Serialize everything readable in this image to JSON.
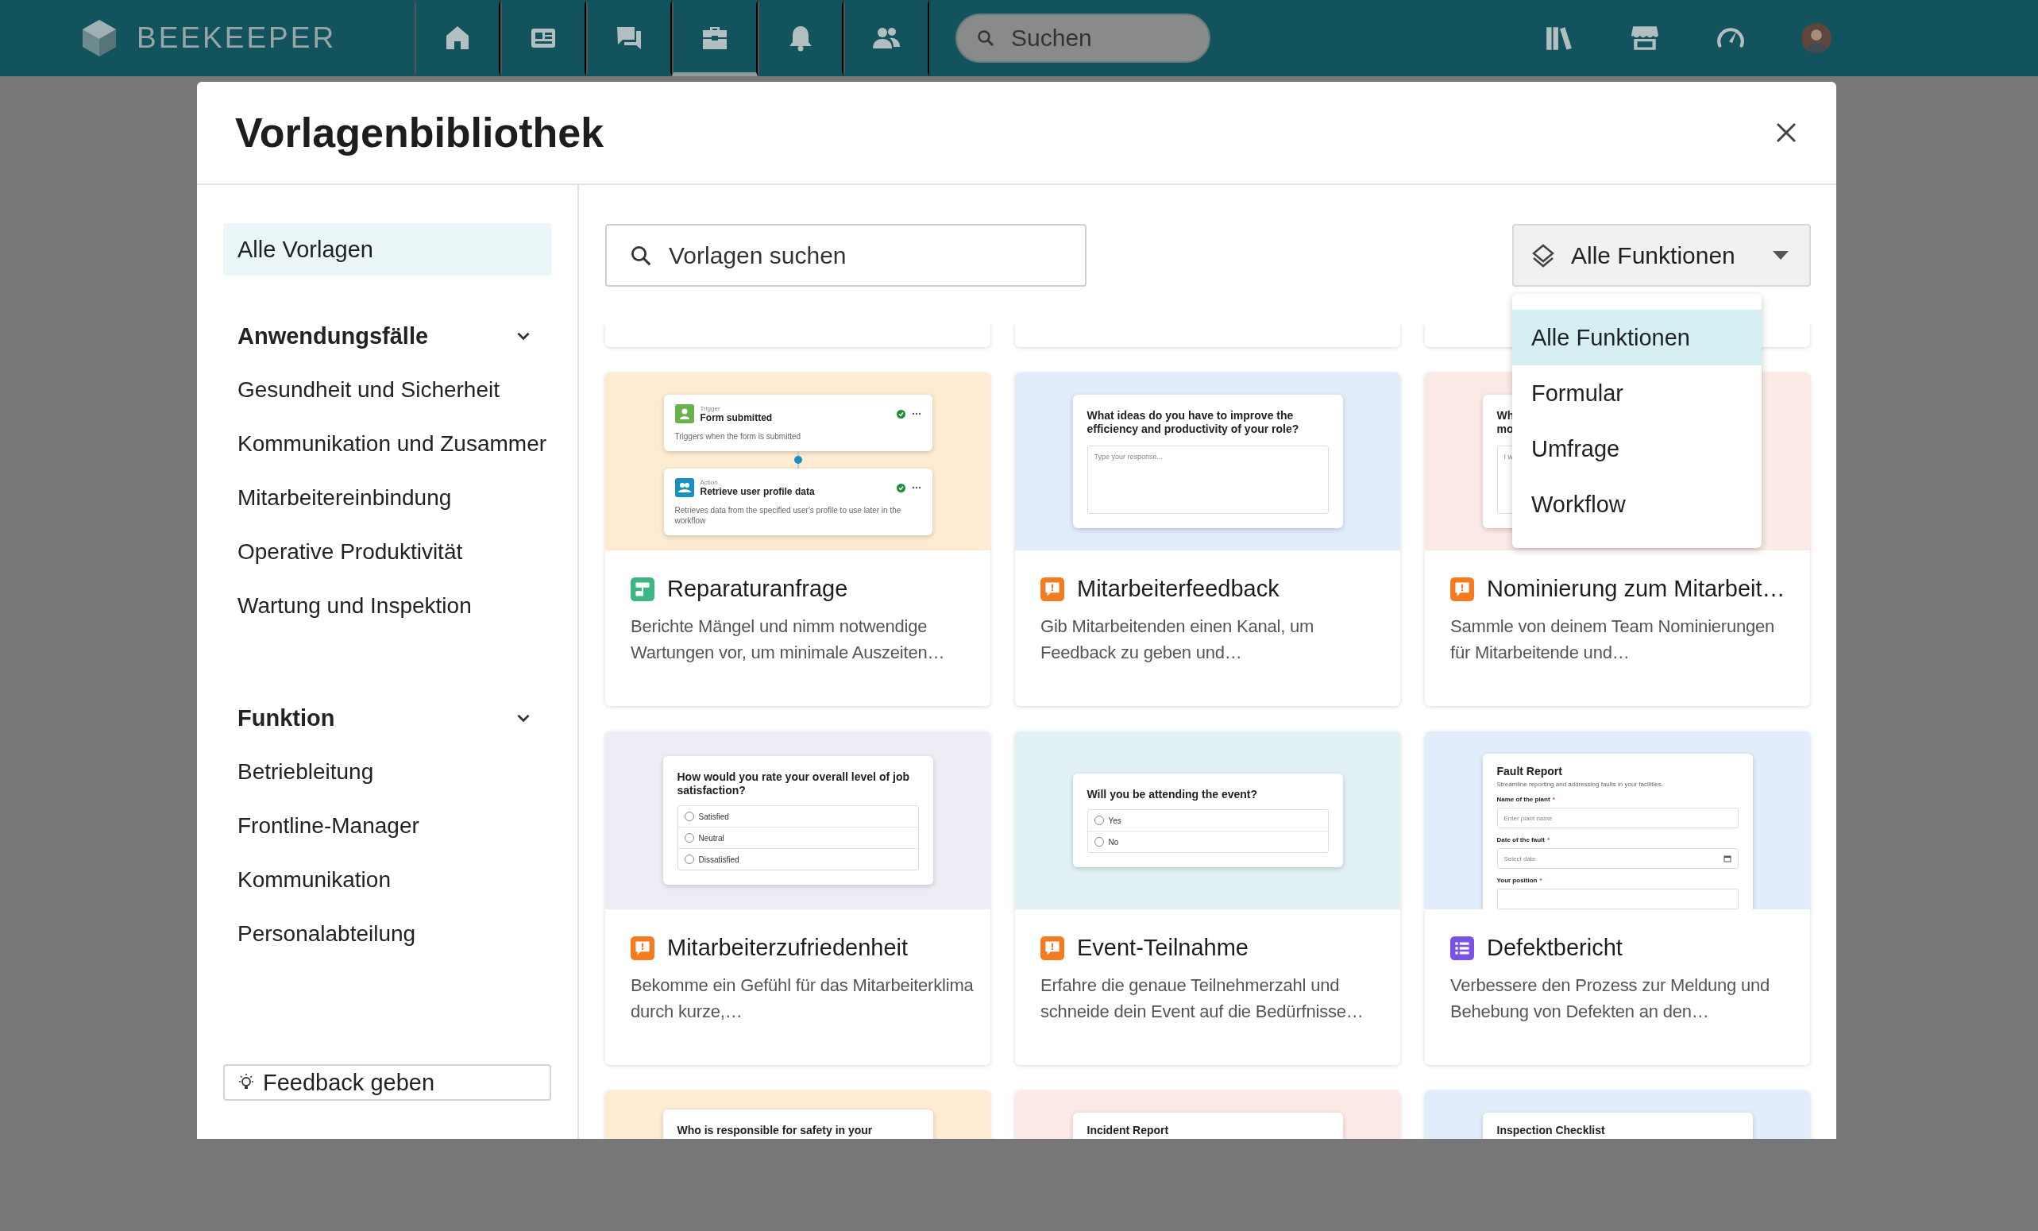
{
  "topbar": {
    "brand": "BEEKEEPER",
    "nav": [
      {
        "kind": "home",
        "selected": false
      },
      {
        "kind": "news",
        "selected": false
      },
      {
        "kind": "chat",
        "selected": false
      },
      {
        "kind": "toolbox",
        "selected": true
      },
      {
        "kind": "bell",
        "selected": false
      },
      {
        "kind": "people",
        "selected": false
      }
    ],
    "search": {
      "placeholder": "Suchen"
    },
    "tools": [
      {
        "kind": "library"
      },
      {
        "kind": "store"
      },
      {
        "kind": "gauge"
      }
    ]
  },
  "modal": {
    "title": "Vorlagenbibliothek"
  },
  "sidebar": {
    "all_item": {
      "label": "Alle Vorlagen",
      "selected": true
    },
    "sections": [
      {
        "title": "Anwendungsfälle",
        "expanded": true,
        "items": [
          {
            "label": "Gesundheit und Sicherheit",
            "selected": false
          },
          {
            "label": "Kommunikation und Zusammer",
            "selected": false
          },
          {
            "label": "Mitarbeitereinbindung",
            "selected": false
          },
          {
            "label": "Operative Produktivität",
            "selected": false
          },
          {
            "label": "Wartung und Inspektion",
            "selected": false
          }
        ]
      },
      {
        "title": "Funktion",
        "expanded": true,
        "items": [
          {
            "label": "Betriebleitung",
            "selected": false
          },
          {
            "label": "Frontline-Manager",
            "selected": false
          },
          {
            "label": "Kommunikation",
            "selected": false
          },
          {
            "label": "Personalabteilung",
            "selected": false
          }
        ]
      }
    ],
    "feedback_button": "Feedback geben"
  },
  "search": {
    "placeholder": "Vorlagen suchen"
  },
  "filter": {
    "label": "Alle Funktionen",
    "open": true,
    "options": [
      {
        "label": "Alle Funktionen",
        "selected": true
      },
      {
        "label": "Formular",
        "selected": false
      },
      {
        "label": "Umfrage",
        "selected": false
      },
      {
        "label": "Workflow",
        "selected": false
      }
    ]
  },
  "cards": [
    {
      "kind": "workflow",
      "title": "Reparaturanfrage",
      "description": "Berichte Mängel und nimm notwendige Wartungen vor, um minimale Auszeiten…",
      "preview": {
        "kind": "workflow",
        "color": "#fdecd2",
        "nodes": [
          {
            "kind": "trigger",
            "label": "Trigger",
            "title": "Form submitted",
            "text": "Triggers when the form is submitted"
          },
          {
            "kind": "action",
            "label": "Action",
            "title": "Retrieve user profile data",
            "text": "Retrieves data from the specified user's profile to use later in the workflow"
          }
        ]
      }
    },
    {
      "kind": "survey",
      "title": "Mitarbeiterfeedback",
      "description": "Gib Mitarbeitenden einen Kanal, um Feedback zu geben und…",
      "preview": {
        "kind": "text_question",
        "color": "#e2edfb",
        "title": "What ideas do you have to improve the efficiency and productivity of your role?",
        "placeholder": "Type your response..."
      }
    },
    {
      "kind": "survey",
      "title": "Nominierung zum Mitarbeit…",
      "description": "Sammle von deinem Team Nominierungen für Mitarbeitende und…",
      "preview": {
        "kind": "text_question",
        "color": "#fbe9e6",
        "title": "Wh\nmo",
        "placeholder": "I w"
      }
    },
    {
      "kind": "survey",
      "title": "Mitarbeiterzufriedenheit",
      "description": "Bekomme ein Gefühl für das Mitarbeiterklima durch kurze,…",
      "preview": {
        "kind": "choice_question",
        "color": "#ededf6",
        "title": "How would you rate your overall level of job satisfaction?",
        "options": [
          {
            "label": "Satisfied",
            "selected": false
          },
          {
            "label": "Neutral",
            "selected": false
          },
          {
            "label": "Dissatisfied",
            "selected": false
          }
        ]
      }
    },
    {
      "kind": "survey",
      "title": "Event-Teilnahme",
      "description": "Erfahre die genaue Teilnehmerzahl und schneide dein Event auf die Bedürfnisse…",
      "preview": {
        "kind": "choice_question",
        "color": "#e1f1f4",
        "title": "Will you be attending the event?",
        "options": [
          {
            "label": "Yes",
            "selected": false
          },
          {
            "label": "No",
            "selected": false
          }
        ]
      }
    },
    {
      "kind": "form",
      "title": "Defektbericht",
      "description": "Verbessere den Prozess zur Meldung und Behebung von Defekten an den…",
      "preview": {
        "kind": "form",
        "color": "#e2edfb",
        "title": "Fault Report",
        "subtitle": "Streamline reporting and addressing faults in your facilities.",
        "fields": [
          {
            "kind": "text",
            "label": "Name of the plant",
            "required_mark": "*",
            "placeholder": "Enter plant name"
          },
          {
            "kind": "date",
            "label": "Date of the fault",
            "required_mark": "*",
            "placeholder": "Select date"
          },
          {
            "kind": "text",
            "label": "Your position",
            "required_mark": "*"
          }
        ]
      }
    },
    {
      "preview": {
        "kind": "choice_question",
        "color": "#fdecd2",
        "title": "Who is responsible for safety in your"
      }
    },
    {
      "preview": {
        "kind": "form",
        "color": "#fbe9e6",
        "title": "Incident Report"
      }
    },
    {
      "preview": {
        "kind": "form",
        "color": "#e2edfb",
        "title": "Inspection Checklist"
      }
    }
  ]
}
